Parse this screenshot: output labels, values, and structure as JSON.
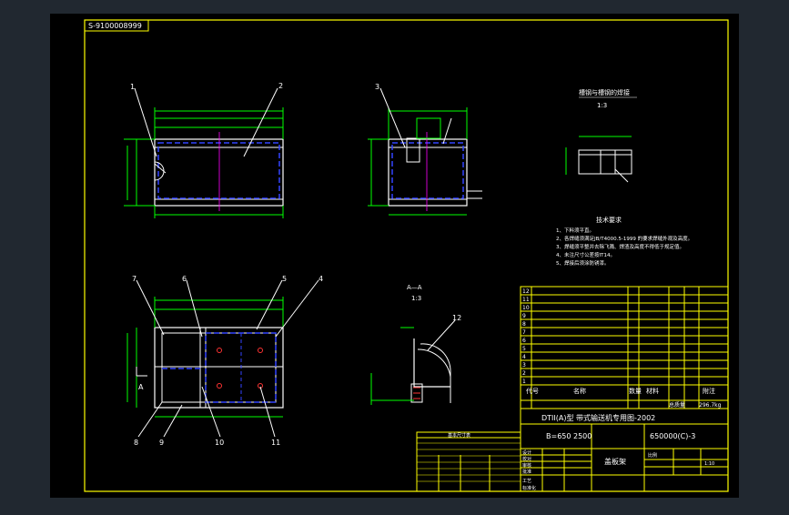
{
  "drawing": {
    "ref_number": "S-9100008999",
    "callouts": {
      "c1": "1",
      "c2": "2",
      "c3": "3",
      "c4": "4",
      "c5": "5",
      "c6": "6",
      "c7": "7",
      "c8": "8",
      "c9": "9",
      "c10": "10",
      "c11": "11",
      "c12": "12"
    },
    "section_label": "A—A",
    "section_scale": "1:3",
    "detail_title": "槽钢与槽钢的焊接",
    "detail_scale": "1:3",
    "section_mark_a": "A",
    "tech_req_title": "技术要求",
    "tech_req_items": [
      "1、下料须平直。",
      "2、各焊缝须满足JB/T4000.5-1999 的要求焊缝外观及高度。",
      "3、焊缝须平整并去除飞溅、焊渣及高度不得低于规定值。",
      "4、未注尺寸公差按IT14。",
      "5、焊接后须涂防锈漆。"
    ],
    "title_block": {
      "series": "DTII(A)型  带式输送机专用图-2002",
      "spec": "B=650 2500",
      "drawing_no": "650000(C)-3",
      "part_name": "盖板架",
      "total_weight_label": "总质量",
      "total_weight": "296.7kg",
      "bom_header": {
        "no": "代号",
        "name": "名称",
        "qty": "数量",
        "material": "材料",
        "note": "附注"
      },
      "bom_row_numbers": [
        "12",
        "11",
        "10",
        "9",
        "8",
        "7",
        "6",
        "5",
        "4",
        "3",
        "2",
        "1"
      ],
      "approvals": [
        "设计",
        "校对",
        "审核",
        "批准",
        "工艺",
        "标准化"
      ],
      "scale_label": "比例",
      "sheet": "1:10"
    },
    "load_table_title": "基本尺寸表"
  },
  "colors": {
    "background": "#212830",
    "paper": "#000000",
    "frame": "#ffff00",
    "outline": "#ffffff",
    "dimension": "#00ff00",
    "hidden": "#3333ff",
    "center": "#ff00ff",
    "accent": "#ff3333"
  }
}
